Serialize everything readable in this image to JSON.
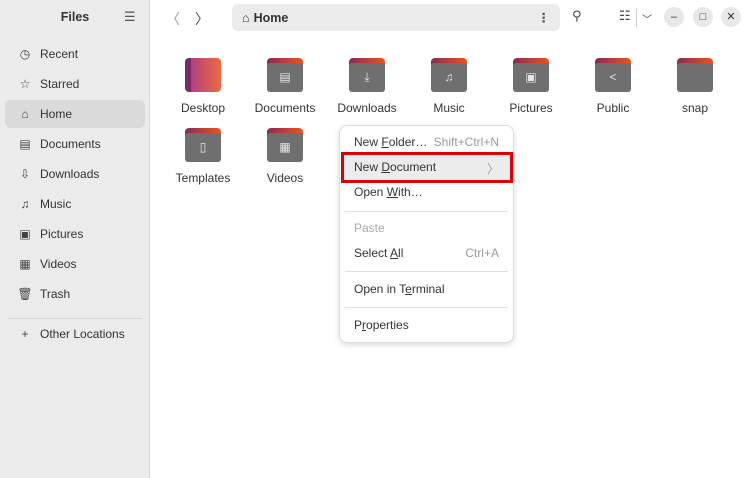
{
  "sidebar": {
    "title": "Files",
    "items": [
      {
        "label": "Recent",
        "icon": "◷"
      },
      {
        "label": "Starred",
        "icon": "☆"
      },
      {
        "label": "Home",
        "icon": "⌂"
      },
      {
        "label": "Documents",
        "icon": "▤"
      },
      {
        "label": "Downloads",
        "icon": "⇩"
      },
      {
        "label": "Music",
        "icon": "♫"
      },
      {
        "label": "Pictures",
        "icon": "▣"
      },
      {
        "label": "Videos",
        "icon": "▦"
      },
      {
        "label": "Trash",
        "icon": "🗑"
      }
    ],
    "other": {
      "label": "Other Locations",
      "icon": "+"
    }
  },
  "header": {
    "path": "Home"
  },
  "files": [
    {
      "label": "Desktop",
      "icon": ""
    },
    {
      "label": "Documents",
      "icon": "▤"
    },
    {
      "label": "Downloads",
      "icon": "⤓"
    },
    {
      "label": "Music",
      "icon": "♫"
    },
    {
      "label": "Pictures",
      "icon": "▣"
    },
    {
      "label": "Public",
      "icon": "<"
    },
    {
      "label": "snap",
      "icon": ""
    },
    {
      "label": "Templates",
      "icon": "▯"
    },
    {
      "label": "Videos",
      "icon": "▦"
    }
  ],
  "menu": [
    {
      "pre": "New ",
      "m": "F",
      "post": "older…",
      "shortcut": "Shift+Ctrl+N"
    },
    {
      "pre": "New ",
      "m": "D",
      "post": "ocument",
      "shortcut": "〉"
    },
    {
      "pre": "Open ",
      "m": "W",
      "post": "ith…",
      "shortcut": ""
    },
    {
      "pre": "Paste",
      "m": "",
      "post": "",
      "shortcut": ""
    },
    {
      "pre": "Select ",
      "m": "A",
      "post": "ll",
      "shortcut": "Ctrl+A"
    },
    {
      "pre": "Open in T",
      "m": "e",
      "post": "rminal",
      "shortcut": ""
    },
    {
      "pre": "P",
      "m": "r",
      "post": "operties",
      "shortcut": ""
    }
  ]
}
